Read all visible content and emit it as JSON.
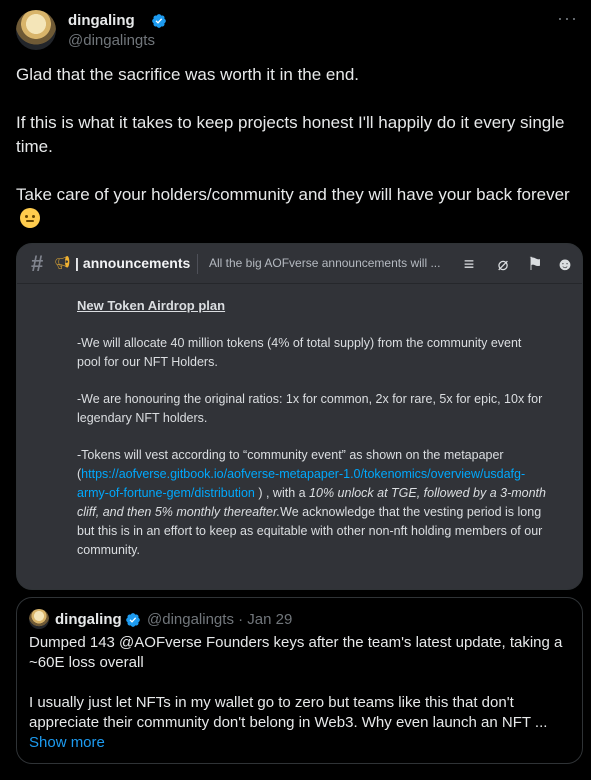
{
  "author": {
    "name": "dingaling",
    "handle": "@dingalingts"
  },
  "more_label": "···",
  "tweet": {
    "line1": "Glad that the sacrifice was worth it in the end.",
    "line2": "If this is what it takes to keep projects honest I'll happily do it every single time.",
    "line3": "Take care of your holders/community and they will have your back forever"
  },
  "discord": {
    "hash": "#",
    "channel": "announcements",
    "channel_sep": "|",
    "topic": "All the big AOFverse announcements will ...",
    "title": "New Token Airdrop plan",
    "p1": "-We will allocate 40 million tokens (4% of total supply) from the community event pool for our NFT Holders.",
    "p2": "-We are honouring the original ratios: 1x for common, 2x for rare, 5x for epic, 10x for legendary NFT holders.",
    "p3_start": "-Tokens will vest according to “community event” as shown on the metapaper (",
    "p3_link": "https://aofverse.gitbook.io/aofverse-metapaper-1.0/tokenomics/overview/usdafg-army-of-fortune-gem/distribution",
    "p3_mid": " ) , with a ",
    "p3_italic": "10% unlock at TGE, followed by a 3-month cliff, and then 5% monthly thereafter.",
    "p3_end": "We acknowledge that the vesting period is long but this is in an effort to keep as equitable with other non-nft holding members of our community."
  },
  "quote": {
    "name": "dingaling",
    "handle_date": "@dingalingts · Jan 29",
    "p1": "Dumped 143 @AOFverse Founders keys after the team's latest update, taking a ~60E loss overall",
    "p2_line1": "I usually just let NFTs in my wallet go to zero but teams like this that don't",
    "p2_line2": "appreciate their community don't belong in Web3. Why even launch an NFT ...",
    "show_more": "Show more"
  },
  "colors": {
    "background": "#000000",
    "verified": "#1d9bf0",
    "link": "#1d9bf0",
    "discord_bg": "#313338",
    "discord_link": "#00a8fc"
  }
}
